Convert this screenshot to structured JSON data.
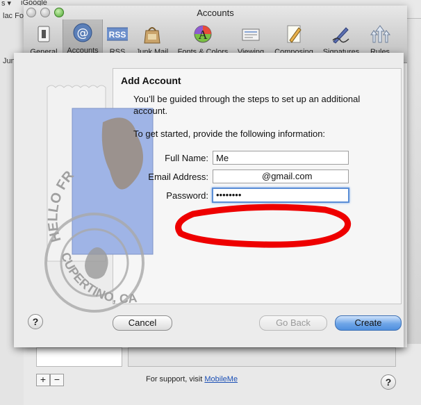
{
  "background": {
    "top_left_text": "s ▾",
    "top_bookmark": "iGoogle",
    "side_text_1": "lac Fo",
    "side_text_2": "Junk",
    "support_text": "For support, visit",
    "support_link": "MobileMe",
    "help_glyph": "?",
    "plus_label": "+",
    "minus_label": "−"
  },
  "window": {
    "title": "Accounts",
    "toolbar": [
      {
        "id": "general",
        "label": "General",
        "icon": "light-switch-icon",
        "selected": false
      },
      {
        "id": "accounts",
        "label": "Accounts",
        "icon": "at-sign-icon",
        "selected": true
      },
      {
        "id": "rss",
        "label": "RSS",
        "icon": "rss-icon",
        "selected": false
      },
      {
        "id": "junk",
        "label": "Junk Mail",
        "icon": "junk-bag-icon",
        "selected": false
      },
      {
        "id": "fonts",
        "label": "Fonts & Colors",
        "icon": "font-colors-icon",
        "selected": false
      },
      {
        "id": "viewing",
        "label": "Viewing",
        "icon": "viewing-icon",
        "selected": false
      },
      {
        "id": "composing",
        "label": "Composing",
        "icon": "pencil-icon",
        "selected": false
      },
      {
        "id": "signatures",
        "label": "Signatures",
        "icon": "signature-pen-icon",
        "selected": false
      },
      {
        "id": "rules",
        "label": "Rules",
        "icon": "rules-arrows-icon",
        "selected": false
      }
    ],
    "rss_badge": "RSS",
    "at_glyph": "@",
    "font_glyph": "A"
  },
  "sheet": {
    "title": "Add Account",
    "intro": "You’ll be guided through the steps to set up an additional account.",
    "prompt": "To get started, provide the following information:",
    "fields": {
      "full_name_label": "Full Name:",
      "full_name_value": "Me",
      "email_label": "Email Address:",
      "email_value": "@gmail.com",
      "password_label": "Password:",
      "password_value": "••••••••"
    },
    "buttons": {
      "help": "?",
      "cancel": "Cancel",
      "back": "Go Back",
      "create": "Create"
    },
    "stamp": {
      "text_top": "HELLO FR",
      "text_bottom": "CUPERTINO, CA"
    }
  },
  "colors": {
    "annotation_red": "#ee0000",
    "focus_blue": "#5b8ed6",
    "default_button": "#6ea5e8"
  }
}
